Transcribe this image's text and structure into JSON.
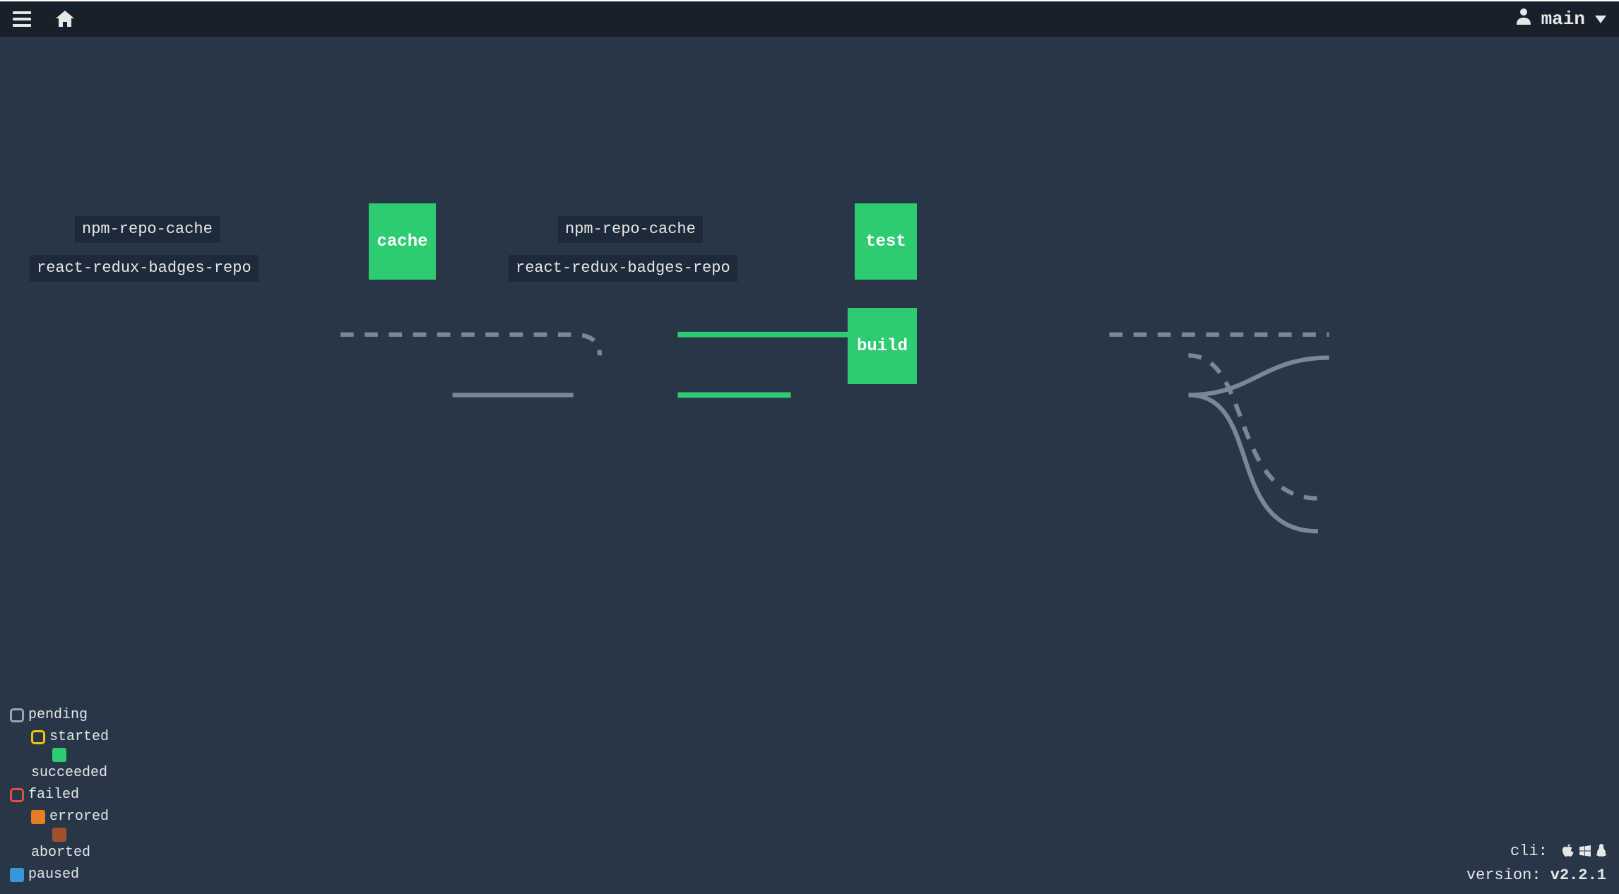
{
  "header": {
    "user_label": "main"
  },
  "pipeline": {
    "resources_left": [
      {
        "id": "npm-repo-cache-in",
        "label": "npm-repo-cache"
      },
      {
        "id": "react-redux-badges-repo-in",
        "label": "react-redux-badges-repo"
      }
    ],
    "resources_mid": [
      {
        "id": "npm-repo-cache-out",
        "label": "npm-repo-cache"
      },
      {
        "id": "react-redux-badges-repo-out",
        "label": "react-redux-badges-repo"
      }
    ],
    "jobs": [
      {
        "id": "cache",
        "label": "cache"
      },
      {
        "id": "test",
        "label": "test"
      },
      {
        "id": "build",
        "label": "build"
      }
    ]
  },
  "legend": [
    {
      "state": "pending",
      "label": "pending"
    },
    {
      "state": "started",
      "label": "started"
    },
    {
      "state": "succeeded",
      "label": "succeeded"
    },
    {
      "state": "failed",
      "label": "failed"
    },
    {
      "state": "errored",
      "label": "errored"
    },
    {
      "state": "aborted",
      "label": "aborted"
    },
    {
      "state": "paused",
      "label": "paused"
    }
  ],
  "footer": {
    "cli_label": "cli:",
    "version_label": "version:",
    "version_value": "v2.2.1"
  }
}
